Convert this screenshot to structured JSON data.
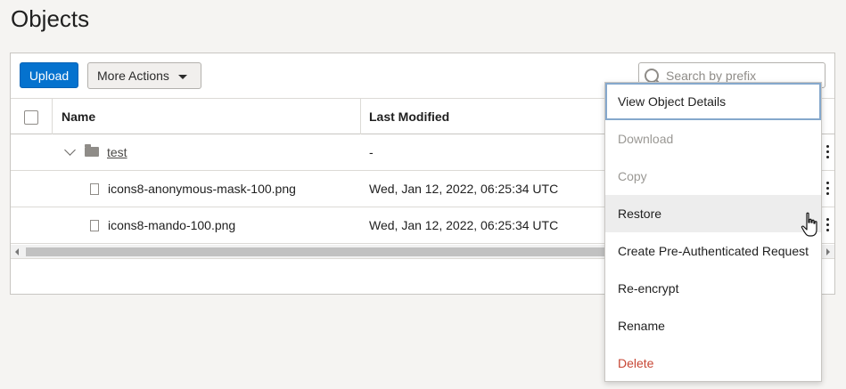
{
  "page": {
    "title": "Objects"
  },
  "toolbar": {
    "upload_label": "Upload",
    "more_actions_label": "More Actions",
    "search_placeholder": "Search by prefix"
  },
  "table": {
    "columns": [
      "Name",
      "Last Modified"
    ],
    "rows": [
      {
        "type": "folder",
        "name": "test",
        "last_modified": "-"
      },
      {
        "type": "file",
        "name": "icons8-anonymous-mask-100.png",
        "last_modified": "Wed, Jan 12, 2022, 06:25:34 UTC"
      },
      {
        "type": "file",
        "name": "icons8-mando-100.png",
        "last_modified": "Wed, Jan 12, 2022, 06:25:34 UTC"
      }
    ]
  },
  "context_menu": {
    "items": [
      {
        "label": "View Object Details",
        "state": "focused"
      },
      {
        "label": "Download",
        "state": "disabled"
      },
      {
        "label": "Copy",
        "state": "disabled"
      },
      {
        "label": "Restore",
        "state": "hover"
      },
      {
        "label": "Create Pre-Authenticated Request",
        "state": "normal"
      },
      {
        "label": "Re-encrypt",
        "state": "normal"
      },
      {
        "label": "Rename",
        "state": "normal"
      },
      {
        "label": "Delete",
        "state": "danger"
      }
    ]
  },
  "icons": {
    "search": "search-icon",
    "dropdown": "caret-down-icon",
    "folder": "folder-icon",
    "file": "file-icon",
    "row_actions": "kebab-menu-icon",
    "pointer": "hand-cursor-icon"
  },
  "colors": {
    "primary": "#0572ce",
    "danger": "#c74634",
    "disabled": "#9a9894"
  }
}
